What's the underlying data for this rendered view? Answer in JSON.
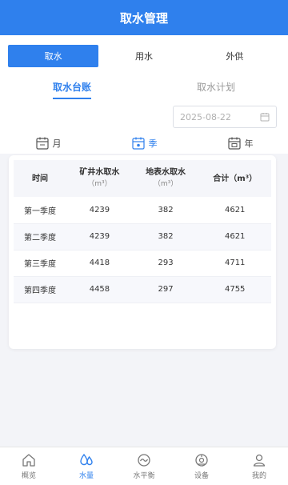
{
  "header": {
    "title": "取水管理"
  },
  "top_tabs": [
    {
      "label": "取水",
      "active": true
    },
    {
      "label": "用水",
      "active": false
    },
    {
      "label": "外供",
      "active": false
    }
  ],
  "sub_tabs": [
    {
      "label": "取水台账",
      "active": true
    },
    {
      "label": "取水计划",
      "active": false
    }
  ],
  "date_filter": {
    "value": "2025-08-22",
    "icon": "calendar-icon"
  },
  "periods": [
    {
      "label": "月",
      "active": false,
      "icon": "calendar-month-icon"
    },
    {
      "label": "季",
      "active": true,
      "icon": "calendar-quarter-icon"
    },
    {
      "label": "年",
      "active": false,
      "icon": "calendar-year-icon"
    }
  ],
  "table": {
    "headers": [
      {
        "label": "时间",
        "unit": ""
      },
      {
        "label": "矿井水取水",
        "unit": "（m³）"
      },
      {
        "label": "地表水取水",
        "unit": "（m³）"
      },
      {
        "label": "合计（m³）",
        "unit": ""
      }
    ],
    "rows": [
      [
        "第一季度",
        "4239",
        "382",
        "4621"
      ],
      [
        "第二季度",
        "4239",
        "382",
        "4621"
      ],
      [
        "第三季度",
        "4418",
        "293",
        "4711"
      ],
      [
        "第四季度",
        "4458",
        "297",
        "4755"
      ]
    ]
  },
  "bottom_nav": [
    {
      "label": "概览",
      "icon": "home-icon",
      "active": false
    },
    {
      "label": "水量",
      "icon": "water-drops-icon",
      "active": true
    },
    {
      "label": "水平衡",
      "icon": "balance-gauge-icon",
      "active": false
    },
    {
      "label": "设备",
      "icon": "device-icon",
      "active": false
    },
    {
      "label": "我的",
      "icon": "user-icon",
      "active": false
    }
  ],
  "colors": {
    "primary": "#2f80ed",
    "background": "#f3f4f8"
  }
}
